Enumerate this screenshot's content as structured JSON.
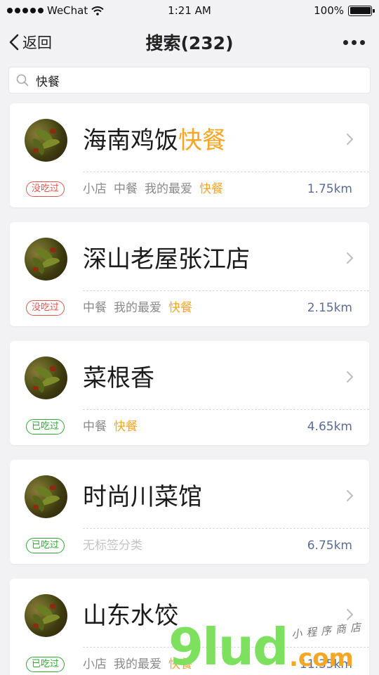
{
  "status_bar": {
    "carrier": "WeChat",
    "time": "1:21 AM",
    "battery": "100%"
  },
  "nav": {
    "back_label": "返回",
    "title": "搜索(232)"
  },
  "search": {
    "value": "快餐"
  },
  "results": [
    {
      "name_plain": "海南鸡饭",
      "name_highlight": "快餐",
      "status": "没吃过",
      "tags": [
        {
          "text": "小店"
        },
        {
          "text": "中餐"
        },
        {
          "text": "我的最爱"
        },
        {
          "text": "快餐",
          "highlight": true
        }
      ],
      "distance": "1.75km"
    },
    {
      "name_plain": "深山老屋张江店",
      "name_highlight": "",
      "status": "没吃过",
      "tags": [
        {
          "text": "中餐"
        },
        {
          "text": "我的最爱"
        },
        {
          "text": "快餐",
          "highlight": true
        }
      ],
      "distance": "2.15km"
    },
    {
      "name_plain": "菜根香",
      "name_highlight": "",
      "status": "已吃过",
      "tags": [
        {
          "text": "中餐"
        },
        {
          "text": "快餐",
          "highlight": true
        }
      ],
      "distance": "4.65km"
    },
    {
      "name_plain": "时尚川菜馆",
      "name_highlight": "",
      "status": "已吃过",
      "tags": [
        {
          "text": "无标签分类",
          "empty": true
        }
      ],
      "distance": "6.75km"
    },
    {
      "name_plain": "山东水饺",
      "name_highlight": "",
      "status": "已吃过",
      "tags": [
        {
          "text": "小店"
        },
        {
          "text": "我的最爱"
        },
        {
          "text": "快餐",
          "highlight": true
        }
      ],
      "distance": "11.35km"
    }
  ],
  "watermark": {
    "brand": "9lud",
    "domain": ".com",
    "tagline": "小程序商店"
  },
  "colors": {
    "highlight": "#f5a623",
    "not_eaten": "#e0544d",
    "eaten": "#2fa832",
    "distance": "#5a6c94"
  }
}
